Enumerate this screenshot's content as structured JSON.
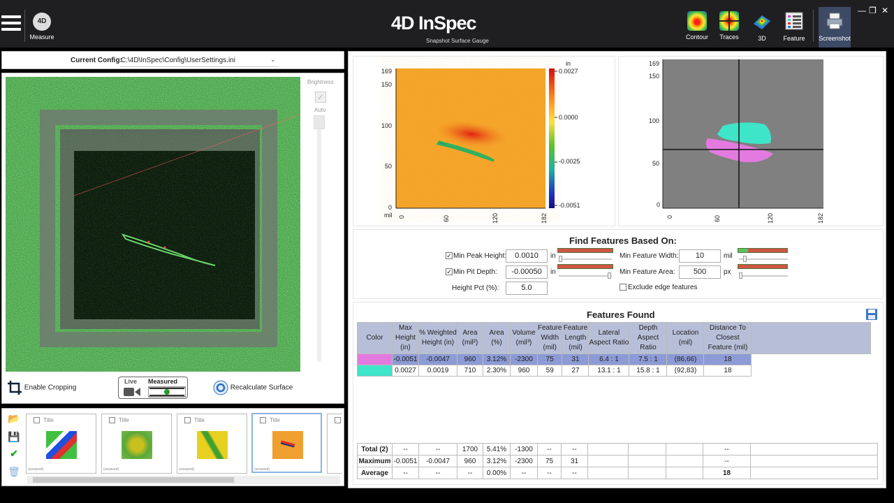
{
  "toolbar": {
    "measure_label": "Measure",
    "measure_icon_text": "4D",
    "logo_brand": "4D InSpec",
    "logo_tagline": "Snapshot Surface Gauge",
    "items": [
      {
        "label": "Contour",
        "icon": "contour-icon"
      },
      {
        "label": "Traces",
        "icon": "traces-icon"
      },
      {
        "label": "3D",
        "icon": "3d-icon"
      },
      {
        "label": "Feature",
        "icon": "feature-icon"
      },
      {
        "label": "Screenshot",
        "icon": "screenshot-icon"
      }
    ],
    "window": {
      "minimize": "—",
      "restore": "❐",
      "close": "✕"
    }
  },
  "config": {
    "label": "Current Config:",
    "value": "C:\\4D\\InSpec\\Config\\UserSettings.ini"
  },
  "camera": {
    "brightness_label": "Brightness",
    "auto_label": "Auto"
  },
  "controls": {
    "crop_label": "Enable Cropping",
    "live_label": "Live",
    "measured_label": "Measured",
    "recalc_label": "Recalculate Surface"
  },
  "thumbnails": [
    {
      "title": "Title",
      "status": "(unsaved)"
    },
    {
      "title": "Title",
      "status": "(unsaved)"
    },
    {
      "title": "Title",
      "status": "(unsaved)"
    },
    {
      "title": "Title",
      "status": "(unsaved)"
    }
  ],
  "height_map": {
    "unit": "in",
    "y_ticks": [
      "169",
      "150",
      "100",
      "50",
      "0"
    ],
    "x_ticks": [
      "0",
      "60",
      "120",
      "182"
    ],
    "x_unit": "mil",
    "colorbar_ticks": [
      "0.0027",
      "0.0000",
      "-0.0025",
      "-0.0051"
    ]
  },
  "feature_map": {
    "y_ticks": [
      "169",
      "150",
      "100",
      "50",
      "0"
    ],
    "x_ticks": [
      "0",
      "60",
      "120",
      "182"
    ]
  },
  "find_features": {
    "title": "Find Features Based On:",
    "min_peak_label": "Min Peak Height:",
    "min_peak_value": "0.0010",
    "min_peak_checked": true,
    "min_pit_label": "Min Pit Depth:",
    "min_pit_value": "-0.00050",
    "min_pit_checked": true,
    "height_pct_label": "Height Pct (%):",
    "height_pct_value": "5.0",
    "unit_in": "in",
    "min_width_label": "Min Feature Width:",
    "min_width_value": "10",
    "unit_mil": "mil",
    "min_area_label": "Min Feature Area:",
    "min_area_value": "500",
    "unit_px": "px",
    "exclude_edge_label": "Exclude edge features"
  },
  "features_found": {
    "title": "Features Found",
    "headers": [
      "Color",
      "Max Height (in)",
      "% Weighted Height (in)",
      "Area (mil²)",
      "Area (%)",
      "Volume (mil³)",
      "Feature Width (mil)",
      "Feature Length (mil)",
      "Lateral Aspect Ratio",
      "Depth Aspect Ratio",
      "Location (mil)",
      "Distance To Closest Feature (mil)"
    ],
    "rows": [
      {
        "color": "#e37ae0",
        "cells": [
          "-0.0051",
          "-0.0047",
          "960",
          "3.12%",
          "-2300",
          "75",
          "31",
          "6.4 : 1",
          "7.5 : 1",
          "(86,66)",
          "18"
        ]
      },
      {
        "color": "#3fe5c8",
        "cells": [
          "0.0027",
          "0.0019",
          "710",
          "2.30%",
          "960",
          "59",
          "27",
          "13.1 : 1",
          "15.8 : 1",
          "(92,83)",
          "18"
        ]
      }
    ],
    "totals": [
      {
        "label": "Total (2)",
        "cells": [
          "--",
          "--",
          "1700",
          "5.41%",
          "-1300",
          "--",
          "--",
          "",
          "",
          "",
          "--"
        ]
      },
      {
        "label": "Maximum",
        "cells": [
          "-0.0051",
          "-0.0047",
          "960",
          "3.12%",
          "-2300",
          "75",
          "31",
          "",
          "",
          "",
          "--"
        ]
      },
      {
        "label": "Average",
        "cells": [
          "--",
          "--",
          "--",
          "0.00%",
          "--",
          "--",
          "--",
          "",
          "",
          "",
          "18"
        ]
      }
    ]
  }
}
